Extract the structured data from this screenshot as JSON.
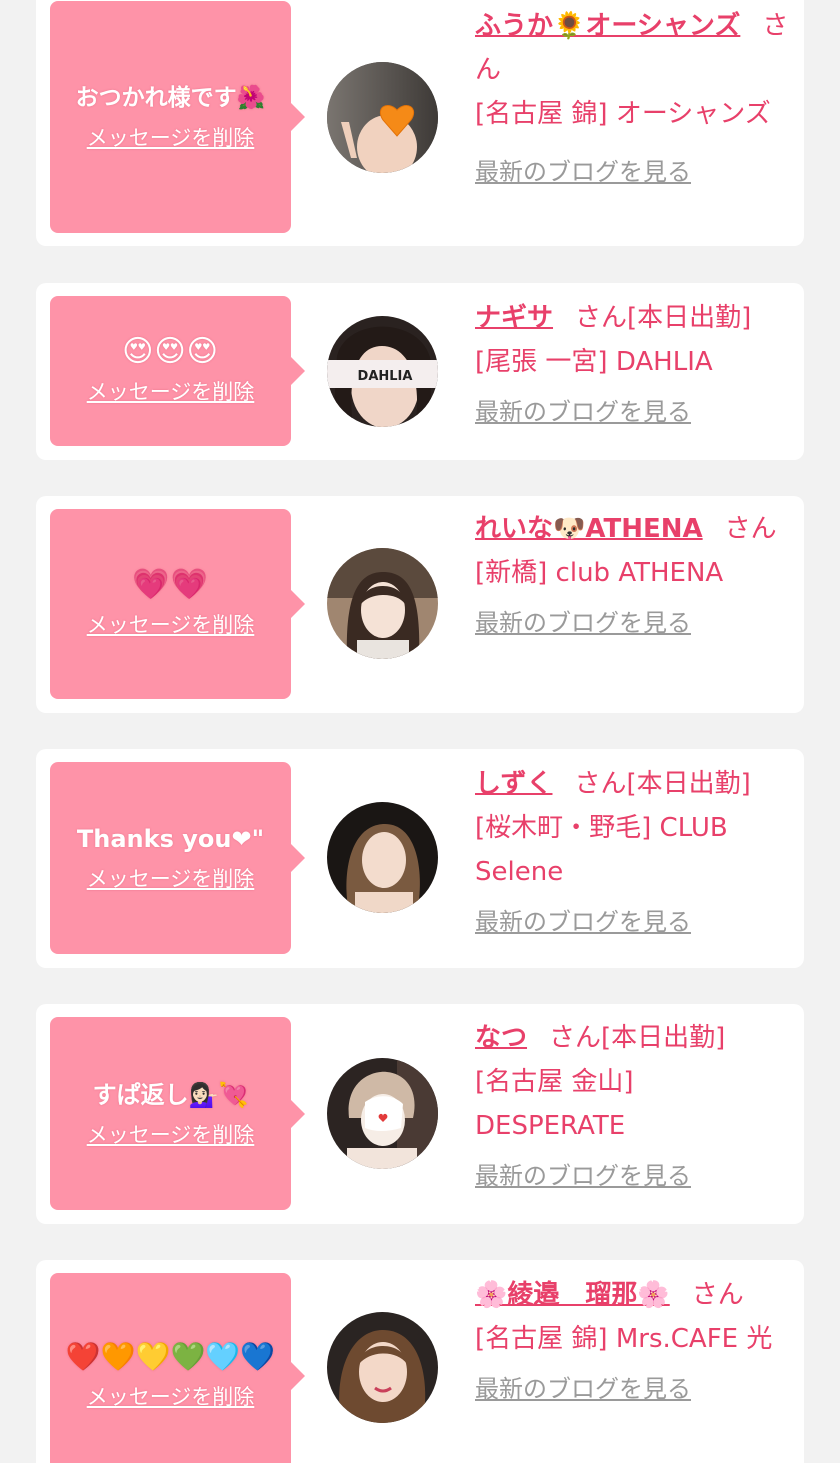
{
  "cards": [
    {
      "message": "おつかれ様です🌺",
      "delete_label": "メッセージを削除",
      "name": "ふうか🌻オーシャンズ",
      "san": "さん",
      "shop": "[名古屋 錦] オーシャンズ",
      "blog_label": "最新のブログを見る",
      "avatar": "avatar-orange-heart"
    },
    {
      "message": "😍😍😍",
      "delete_label": "メッセージを削除",
      "name": "ナギサ",
      "san": "さん[本日出勤]",
      "shop": "[尾張 一宮] DAHLIA",
      "blog_label": "最新のブログを見る",
      "avatar": "avatar-dahlia",
      "avatar_text": "DAHLIA"
    },
    {
      "message": "💗💗",
      "delete_label": "メッセージを削除",
      "name": "れいな🐶ATHENA",
      "san": "さん",
      "shop": "[新橋] club ATHENA",
      "blog_label": "最新のブログを見る",
      "avatar": "avatar-woman"
    },
    {
      "message": "Thanks you❤\"",
      "delete_label": "メッセージを削除",
      "name": "しずく",
      "san": "さん[本日出勤]",
      "shop": "[桜木町・野毛] CLUB Selene",
      "blog_label": "最新のブログを見る",
      "avatar": "avatar-woman"
    },
    {
      "message": "すぱ返し💁🏻‍♀️💘",
      "delete_label": "メッセージを削除",
      "name": "なつ",
      "san": "さん[本日出勤]",
      "shop": "[名古屋 金山] DESPERATE",
      "blog_label": "最新のブログを見る",
      "avatar": "avatar-masked"
    },
    {
      "message": "❤️🧡💛💚🩵💙",
      "delete_label": "メッセージを削除",
      "name": "🌸綾邉　瑠那🌸",
      "san": "さん",
      "shop": "[名古屋 錦] Mrs.CAFE 光",
      "blog_label": "最新のブログを見る",
      "avatar": "avatar-woman"
    }
  ]
}
